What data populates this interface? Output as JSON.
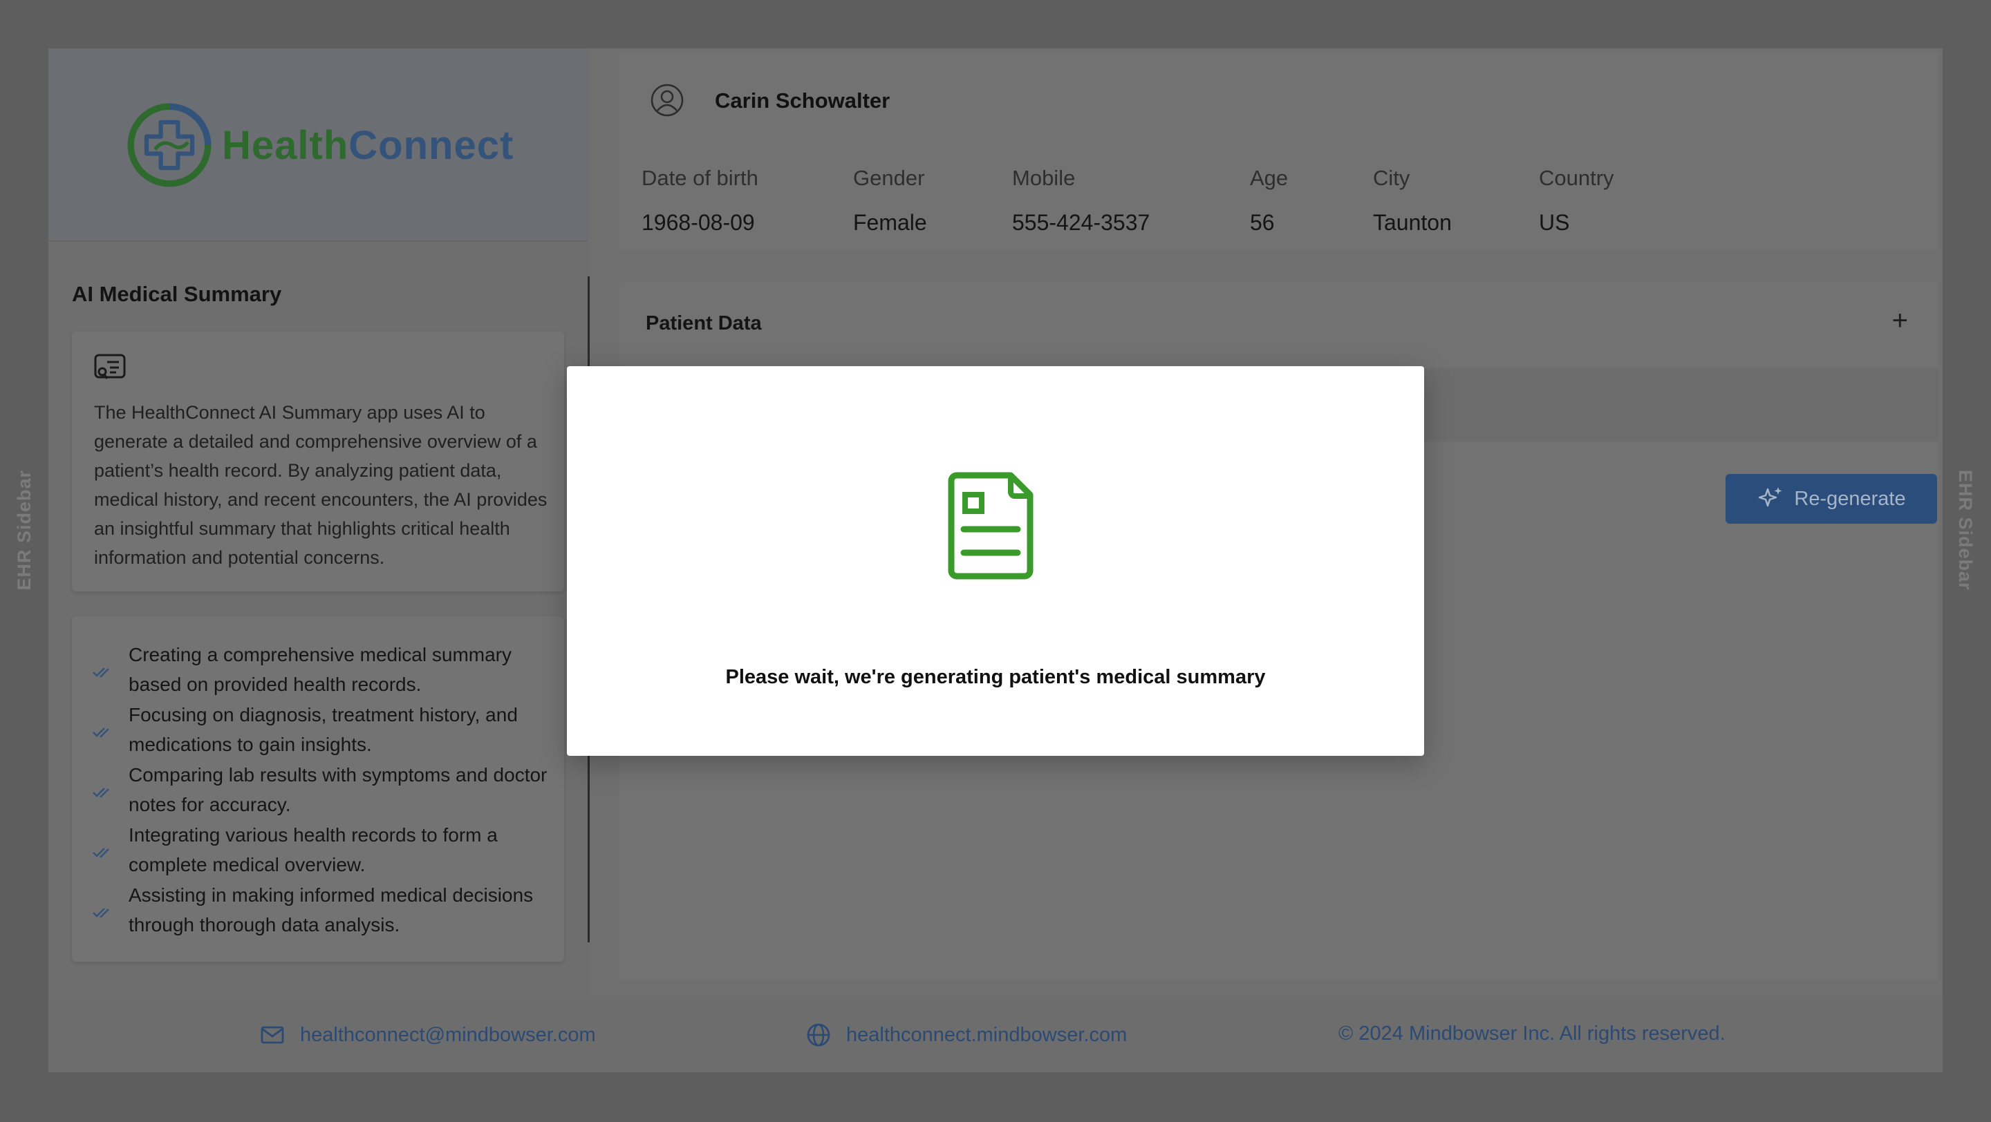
{
  "side_labels": {
    "left": "EHR Sidebar",
    "right": "EHR Sidebar"
  },
  "brand": {
    "part1": "Health",
    "part2": "Connect",
    "colors": {
      "health": "#2e8b2a",
      "connect": "#2d5a9e"
    }
  },
  "summary_panel": {
    "title": "AI Medical Summary",
    "description": "The HealthConnect AI Summary app uses AI to generate a detailed and comprehensive overview of a patient’s health record. By analyzing patient data, medical history, and recent encounters, the AI provides an insightful summary that highlights critical health information and potential concerns.",
    "bullets": [
      "Creating a comprehensive medical summary based on provided health records.",
      "Focusing on diagnosis, treatment history, and medications to gain insights.",
      "Comparing lab results with symptoms and doctor notes for accuracy.",
      "Integrating various health records to form a complete medical overview.",
      "Assisting in making informed medical decisions through thorough data analysis."
    ]
  },
  "patient": {
    "name": "Carin Schowalter",
    "fields": [
      {
        "label": "Date of birth",
        "value": "1968-08-09"
      },
      {
        "label": "Gender",
        "value": "Female"
      },
      {
        "label": "Mobile",
        "value": "555-424-3537"
      },
      {
        "label": "Age",
        "value": "56"
      },
      {
        "label": "City",
        "value": "Taunton"
      },
      {
        "label": "Country",
        "value": "US"
      }
    ]
  },
  "patient_data": {
    "title": "Patient Data",
    "toggle": "+"
  },
  "regenerate": {
    "label": "Re-generate",
    "icon": "sparkles-icon"
  },
  "footer": {
    "email": "healthconnect@mindbowser.com",
    "website": "healthconnect.mindbowser.com",
    "copyright": "© 2024 Mindbowser Inc. All rights reserved."
  },
  "modal": {
    "message": "Please wait, we're generating patient's medical summary",
    "icon": "document-icon",
    "icon_color": "#3a9a2a"
  }
}
